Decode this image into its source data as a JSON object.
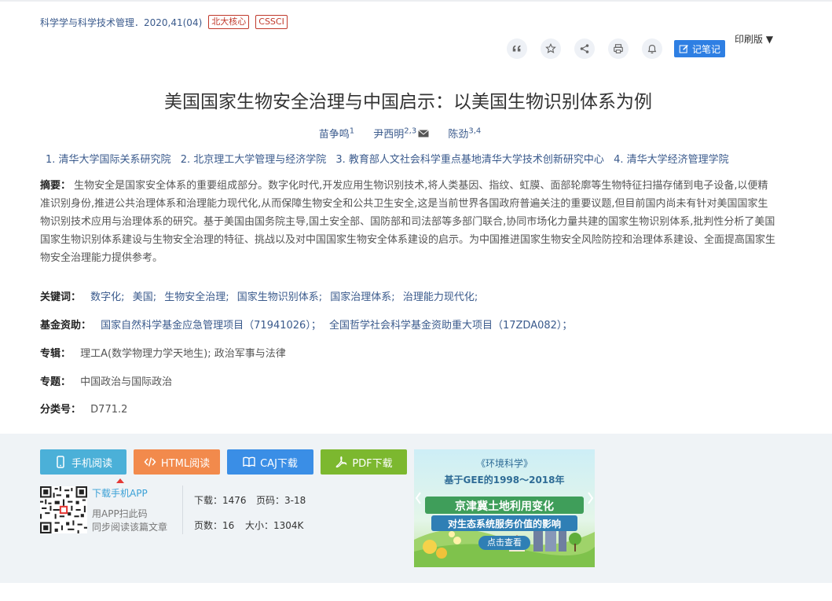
{
  "header": {
    "source": "科学学与科学技术管理．2020,41(04)",
    "badges": [
      "北大核心",
      "CSSCI"
    ],
    "print_label": "印刷版 ▼",
    "note_label": "记笔记"
  },
  "toolbar": {
    "icons": [
      "quote-icon",
      "star-icon",
      "share-icon",
      "print-icon",
      "bell-icon"
    ]
  },
  "article": {
    "title": "美国国家生物安全治理与中国启示：以美国生物识别体系为例",
    "authors": [
      {
        "name": "苗争鸣",
        "sup": "1"
      },
      {
        "name": "尹西明",
        "sup": "2,3"
      },
      {
        "name": "陈劲",
        "sup": "3,4"
      }
    ],
    "orgs": [
      "1. 清华大学国际关系研究院",
      "2. 北京理工大学管理与经济学院",
      "3. 教育部人文社会科学重点基地清华大学技术创新研究中心",
      "4. 清华大学经济管理学院"
    ],
    "abstract_label": "摘要：",
    "abstract": "生物安全是国家安全体系的重要组成部分。数字化时代,开发应用生物识别技术,将人类基因、指纹、虹膜、面部轮廓等生物特征扫描存储到电子设备,以便精准识别身份,推进公共治理体系和治理能力现代化,从而保障生物安全和公共卫生安全,这是当前世界各国政府普遍关注的重要议题,但目前国内尚未有针对美国国家生物识别技术应用与治理体系的研究。基于美国由国务院主导,国土安全部、国防部和司法部等多部门联合,协同市场化力量共建的国家生物识别体系,批判性分析了美国国家生物识别体系建设与生物安全治理的特征、挑战以及对中国国家生物安全体系建设的启示。为中国推进国家生物安全风险防控和治理体系建设、全面提高国家生物安全治理能力提供参考。",
    "keywords_label": "关键词：",
    "keywords": [
      "数字化;",
      "美国;",
      "生物安全治理;",
      "国家生物识别体系;",
      "国家治理体系;",
      "治理能力现代化;"
    ],
    "fund_label": "基金资助：",
    "funds": [
      "国家自然科学基金应急管理项目（71941026）；",
      "全国哲学社会科学基金资助重大项目（17ZDA082）；"
    ],
    "series_label": "专辑：",
    "series": "理工A(数学物理力学天地生); 政治军事与法律",
    "topic_label": "专题：",
    "topic": "中国政治与国际政治",
    "class_label": "分类号：",
    "class": "D771.2"
  },
  "actions": {
    "mobile": "手机阅读",
    "html": "HTML阅读",
    "caj": "CAJ下载",
    "pdf": "PDF下载"
  },
  "app": {
    "link": "下载手机APP",
    "tip1": "用APP扫此码",
    "tip2": "同步阅读该篇文章"
  },
  "stats": {
    "downloads": "下载：1476",
    "pages_range": "页码：3-18",
    "pages": "页数：16",
    "size": "大小：1304K"
  },
  "ad": {
    "journal": "《环境科学》",
    "line1": "基于GEE的1998～2018年",
    "line2": "京津冀土地利用变化",
    "line3": "对生态系统服务价值的影响",
    "cta": "点击查看"
  },
  "colors": {
    "mobile": "#4bb0d8",
    "html": "#f28a4c",
    "caj": "#3a8ee6",
    "pdf": "#7cb82f",
    "link": "#3a5a8c"
  }
}
